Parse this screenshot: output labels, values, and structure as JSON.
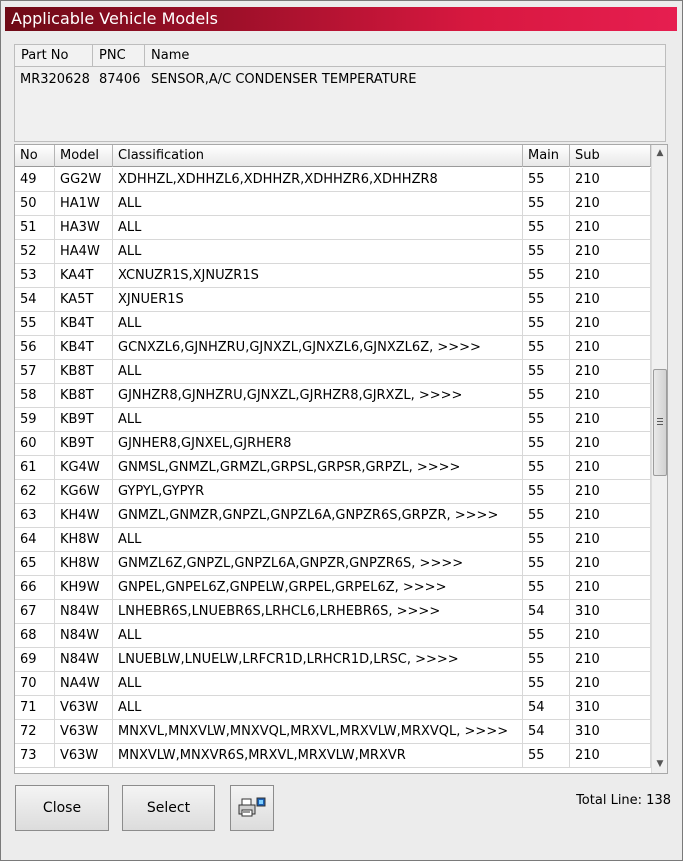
{
  "window": {
    "title": "Applicable Vehicle Models"
  },
  "part_info": {
    "headers": [
      "Part No",
      "PNC",
      "Name"
    ],
    "values": [
      "MR320628",
      "87406",
      "SENSOR,A/C CONDENSER TEMPERATURE"
    ]
  },
  "grid": {
    "headers": [
      "No",
      "Model",
      "Classification",
      "Main",
      "Sub"
    ],
    "rows": [
      [
        "49",
        "GG2W",
        "XDHHZL,XDHHZL6,XDHHZR,XDHHZR6,XDHHZR8",
        "55",
        "210"
      ],
      [
        "50",
        "HA1W",
        "ALL",
        "55",
        "210"
      ],
      [
        "51",
        "HA3W",
        "ALL",
        "55",
        "210"
      ],
      [
        "52",
        "HA4W",
        "ALL",
        "55",
        "210"
      ],
      [
        "53",
        "KA4T",
        "XCNUZR1S,XJNUZR1S",
        "55",
        "210"
      ],
      [
        "54",
        "KA5T",
        "XJNUER1S",
        "55",
        "210"
      ],
      [
        "55",
        "KB4T",
        "ALL",
        "55",
        "210"
      ],
      [
        "56",
        "KB4T",
        "GCNXZL6,GJNHZRU,GJNXZL,GJNXZL6,GJNXZL6Z,  >>>>",
        "55",
        "210"
      ],
      [
        "57",
        "KB8T",
        "ALL",
        "55",
        "210"
      ],
      [
        "58",
        "KB8T",
        "GJNHZR8,GJNHZRU,GJNXZL,GJRHZR8,GJRXZL,  >>>>",
        "55",
        "210"
      ],
      [
        "59",
        "KB9T",
        "ALL",
        "55",
        "210"
      ],
      [
        "60",
        "KB9T",
        "GJNHER8,GJNXEL,GJRHER8",
        "55",
        "210"
      ],
      [
        "61",
        "KG4W",
        "GNMSL,GNMZL,GRMZL,GRPSL,GRPSR,GRPZL,  >>>>",
        "55",
        "210"
      ],
      [
        "62",
        "KG6W",
        "GYPYL,GYPYR",
        "55",
        "210"
      ],
      [
        "63",
        "KH4W",
        "GNMZL,GNMZR,GNPZL,GNPZL6A,GNPZR6S,GRPZR,  >>>>",
        "55",
        "210"
      ],
      [
        "64",
        "KH8W",
        "ALL",
        "55",
        "210"
      ],
      [
        "65",
        "KH8W",
        "GNMZL6Z,GNPZL,GNPZL6A,GNPZR,GNPZR6S,  >>>>",
        "55",
        "210"
      ],
      [
        "66",
        "KH9W",
        "GNPEL,GNPEL6Z,GNPELW,GRPEL,GRPEL6Z,  >>>>",
        "55",
        "210"
      ],
      [
        "67",
        "N84W",
        "LNHEBR6S,LNUEBR6S,LRHCL6,LRHEBR6S,  >>>>",
        "54",
        "310"
      ],
      [
        "68",
        "N84W",
        "ALL",
        "55",
        "210"
      ],
      [
        "69",
        "N84W",
        "LNUEBLW,LNUELW,LRFCR1D,LRHCR1D,LRSC,  >>>>",
        "55",
        "210"
      ],
      [
        "70",
        "NA4W",
        "ALL",
        "55",
        "210"
      ],
      [
        "71",
        "V63W",
        "ALL",
        "54",
        "310"
      ],
      [
        "72",
        "V63W",
        "MNXVL,MNXVLW,MNXVQL,MRXVL,MRXVLW,MRXVQL,  >>>>",
        "54",
        "310"
      ],
      [
        "73",
        "V63W",
        "MNXVLW,MNXVR6S,MRXVL,MRXVLW,MRXVR",
        "55",
        "210"
      ]
    ]
  },
  "buttons": {
    "close": "Close",
    "select": "Select"
  },
  "icons": {
    "print": "printer-icon",
    "scroll_up": "scroll-up-arrow-icon",
    "scroll_down": "scroll-down-arrow-icon"
  },
  "footer": {
    "total": "Total Line: 138"
  },
  "colors": {
    "title_start": "#6e0a16",
    "title_end": "#e61e50"
  }
}
